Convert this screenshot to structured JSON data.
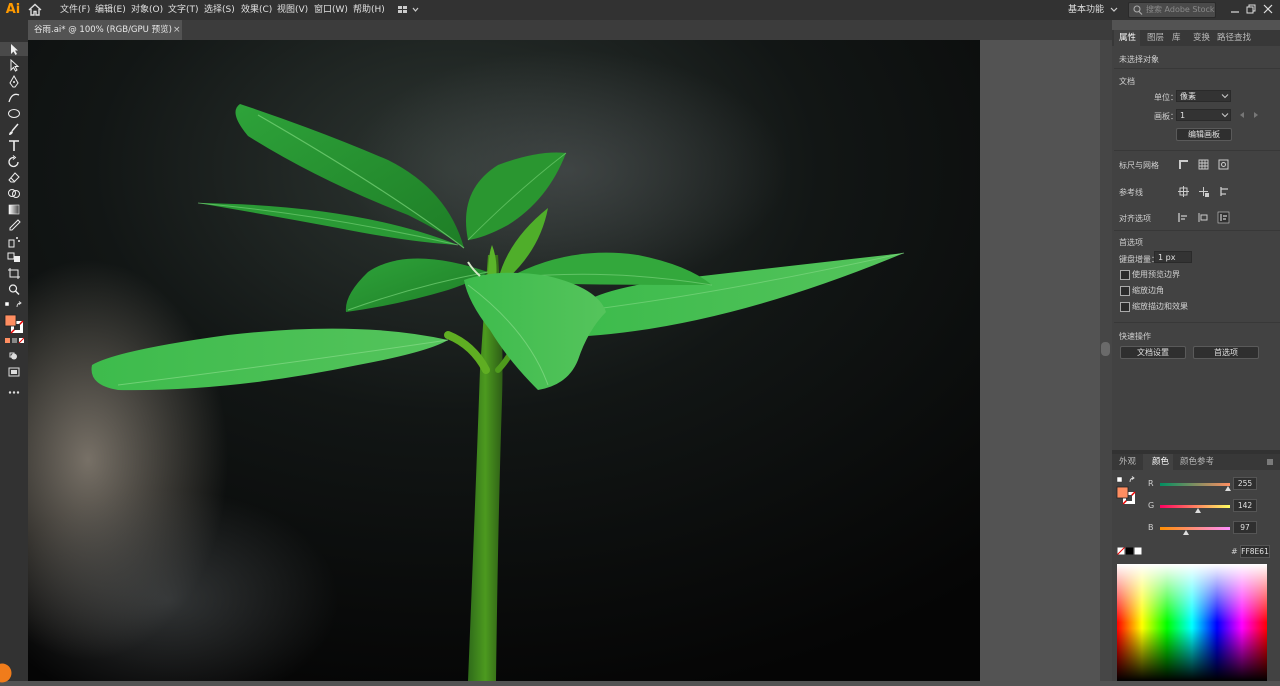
{
  "app": {
    "logo": "Ai"
  },
  "menu": [
    "文件(F)",
    "编辑(E)",
    "对象(O)",
    "文字(T)",
    "选择(S)",
    "效果(C)",
    "视图(V)",
    "窗口(W)",
    "帮助(H)"
  ],
  "workspace": {
    "label": "基本功能"
  },
  "search": {
    "placeholder": "搜索 Adobe Stock"
  },
  "document_tab": {
    "label": "谷雨.ai* @ 100% (RGB/GPU 预览)",
    "close": "×"
  },
  "icons": {
    "home": "home-icon",
    "layout": "arrange-documents-icon",
    "search": "search-icon",
    "tools": [
      "selection-tool-icon",
      "direct-selection-tool-icon",
      "pen-tool-icon",
      "curvature-tool-icon",
      "ellipse-tool-icon",
      "paintbrush-tool-icon",
      "type-tool-icon",
      "rotate-tool-icon",
      "eraser-tool-icon",
      "shape-builder-tool-icon",
      "gradient-tool-icon",
      "eyedropper-tool-icon",
      "symbol-sprayer-tool-icon",
      "blend-tool-icon",
      "artboard-tool-icon",
      "zoom-tool-icon"
    ]
  },
  "properties_panel": {
    "tabs": [
      "属性",
      "图层",
      "库",
      "变换",
      "路径查找"
    ],
    "no_selection": "未选择对象",
    "document_header": "文档",
    "units_label": "单位：",
    "units_value": "像素",
    "artboard_label": "画板：",
    "artboard_value": "1",
    "edit_artboards": "编辑画板",
    "rulers_grids": "标尺与网格",
    "guides": "参考线",
    "align_options": "对齐选项",
    "preferences_header": "首选项",
    "keyboard_increment_label": "键盘增量：",
    "keyboard_increment_value": "1 px",
    "checkboxes": [
      "使用预览边界",
      "缩放边角",
      "缩放描边和效果"
    ],
    "quick_actions": "快速操作",
    "doc_setup_button": "文档设置",
    "preferences_button": "首选项"
  },
  "color_panel": {
    "tabs": [
      "外观",
      "颜色",
      "颜色参考"
    ],
    "r_label": "R",
    "g_label": "G",
    "b_label": "B",
    "r": 255,
    "g": 142,
    "b": 97,
    "hex_label": "#",
    "hex": "FF8E61",
    "fill_color": "#ff8e61"
  },
  "colors": {
    "accent": "#ff8e61",
    "leaf": "#3cb043",
    "ui_dark": "#323232",
    "panel": "#424242"
  }
}
